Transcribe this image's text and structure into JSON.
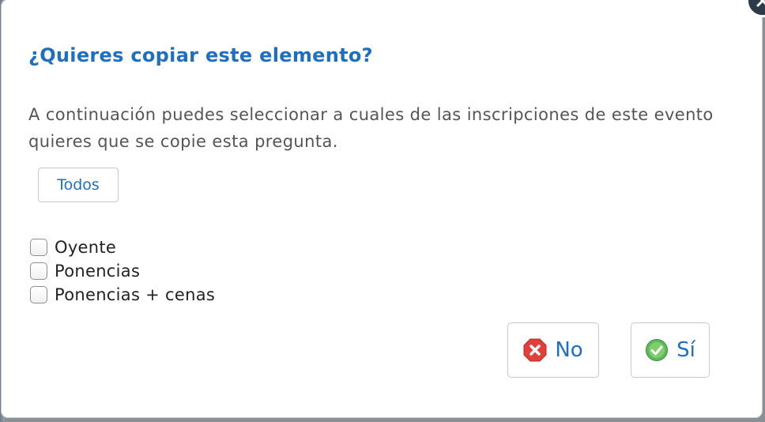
{
  "dialog": {
    "title": "¿Quieres copiar este elemento?",
    "description": "A continuación puedes seleccionar a cuales de las inscripciones de este evento quieres que se copie esta pregunta.",
    "select_all_label": "Todos",
    "close_icon": "close-icon",
    "options": [
      {
        "label": "Oyente",
        "checked": false
      },
      {
        "label": "Ponencias",
        "checked": false
      },
      {
        "label": "Ponencias + cenas",
        "checked": false
      }
    ],
    "buttons": {
      "no_label": "No",
      "no_icon": "x-octagon-icon",
      "yes_label": "Sí",
      "yes_icon": "check-circle-icon"
    }
  },
  "colors": {
    "accent": "#1f6fc0",
    "text": "#555555",
    "no_icon": "#e0403a",
    "yes_icon": "#5cb85c"
  }
}
